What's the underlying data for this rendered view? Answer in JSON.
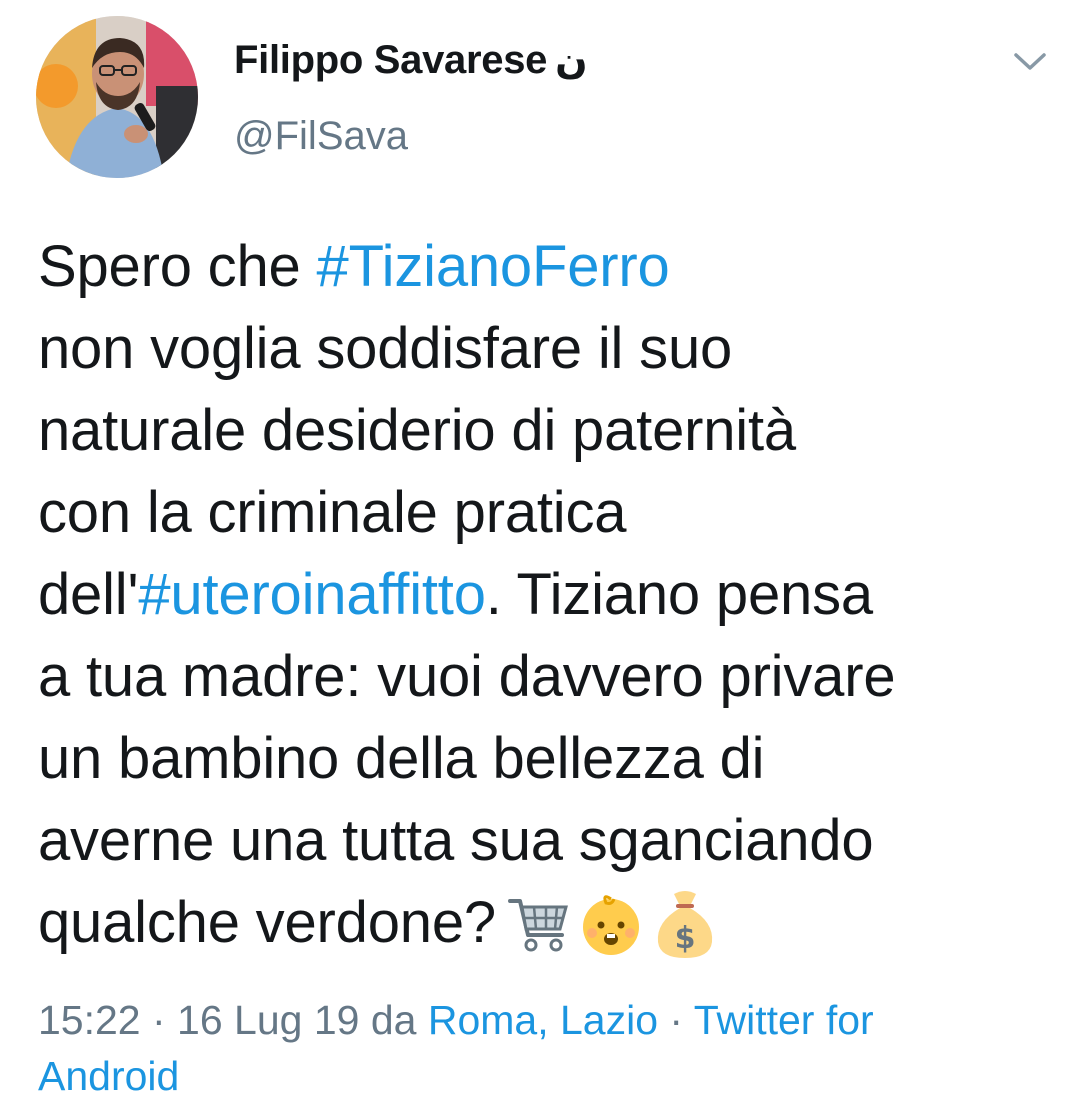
{
  "author": {
    "display_name": "Filippo Savarese",
    "badge": "ن",
    "handle": "@FilSava"
  },
  "tweet": {
    "line1": {
      "pre": "Spero che ",
      "hashtag": "#TizianoFerro"
    },
    "line2": "non voglia soddisfare il suo",
    "line3": "naturale desiderio di paternità",
    "line4": "con la criminale pratica",
    "line5": {
      "pre": "dell'",
      "hashtag": "#uteroinaffitto",
      "post": ". Tiziano pensa"
    },
    "line6": "a tua madre: vuoi davvero privare",
    "line7": "un bambino della bellezza di",
    "line8": "averne una tutta sua sganciando",
    "line9": "qualche verdone?",
    "emojis": [
      "shopping-cart-icon",
      "baby-icon",
      "money-bag-icon"
    ]
  },
  "meta": {
    "time": "15:22",
    "sep1": " · ",
    "date": "16 Lug 19",
    "from": " da ",
    "location": "Roma, Lazio",
    "sep2": " · ",
    "client_part1": "Twitter for",
    "client_part2": "Android"
  },
  "colors": {
    "link": "#1b95e0",
    "text": "#14171a",
    "secondary": "#657786"
  }
}
